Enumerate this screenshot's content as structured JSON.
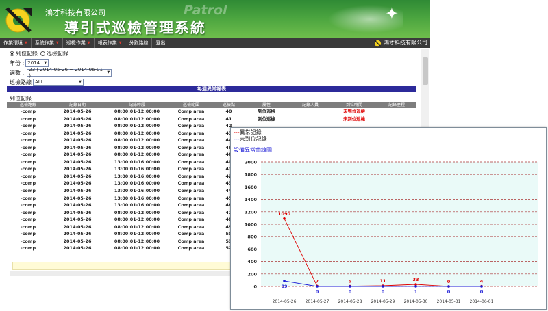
{
  "header": {
    "company": "鴻才科技有限公司",
    "system_title": "導引式巡檢管理系統",
    "watermark": "Patrol"
  },
  "menu": [
    {
      "label": "作業環境",
      "has_dropdown": true
    },
    {
      "label": "系統作業",
      "has_dropdown": true
    },
    {
      "label": "巡檢作業",
      "has_dropdown": true
    },
    {
      "label": "報表作業",
      "has_dropdown": true
    },
    {
      "label": "分割路線",
      "has_dropdown": false
    },
    {
      "label": "登出",
      "has_dropdown": false
    }
  ],
  "menu_brand": "鴻才科技有限公司",
  "filters": {
    "radio_arrived": "到位記錄",
    "radio_inspect": "巡檢記錄",
    "year_label": "年份 :",
    "year_value": "2014",
    "week_label": "週數 :",
    "week_value": "23 ( 2014-05-26 ~ 2014-06-01 )",
    "route_label": "巡檢路線",
    "route_value": "ALL"
  },
  "report": {
    "title": "每週異常報表",
    "section": "到位記錄",
    "columns": [
      "巡檢路線",
      "記錄日期",
      "記錄時段",
      "巡檢範圍",
      "巡檢點",
      "屬性",
      "記錄人員",
      "到位時間",
      "記錄歷程"
    ],
    "rows": [
      [
        "-comp",
        "2014-05-26",
        "08:00:01-12:00:00",
        "Comp area",
        "40",
        "到位巡檢",
        "",
        "未到位巡檢",
        ""
      ],
      [
        "-comp",
        "2014-05-26",
        "08:00:01-12:00:00",
        "Comp area",
        "41",
        "到位巡檢",
        "",
        "未到位巡檢",
        ""
      ],
      [
        "-comp",
        "2014-05-26",
        "08:00:01-12:00:00",
        "Comp area",
        "42",
        "",
        "",
        "",
        ""
      ],
      [
        "-comp",
        "2014-05-26",
        "08:00:01-12:00:00",
        "Comp area",
        "43",
        "",
        "",
        "",
        ""
      ],
      [
        "-comp",
        "2014-05-26",
        "08:00:01-12:00:00",
        "Comp area",
        "44",
        "",
        "",
        "",
        ""
      ],
      [
        "-comp",
        "2014-05-26",
        "08:00:01-12:00:00",
        "Comp area",
        "45",
        "",
        "",
        "",
        ""
      ],
      [
        "-comp",
        "2014-05-26",
        "08:00:01-12:00:00",
        "Comp area",
        "46",
        "",
        "",
        "",
        ""
      ],
      [
        "-comp",
        "2014-05-26",
        "13:00:01-16:00:00",
        "Comp area",
        "40",
        "",
        "",
        "",
        ""
      ],
      [
        "-comp",
        "2014-05-26",
        "13:00:01-16:00:00",
        "Comp area",
        "41",
        "",
        "",
        "",
        ""
      ],
      [
        "-comp",
        "2014-05-26",
        "13:00:01-16:00:00",
        "Comp area",
        "42",
        "",
        "",
        "",
        ""
      ],
      [
        "-comp",
        "2014-05-26",
        "13:00:01-16:00:00",
        "Comp area",
        "43",
        "",
        "",
        "",
        ""
      ],
      [
        "-comp",
        "2014-05-26",
        "13:00:01-16:00:00",
        "Comp area",
        "44",
        "",
        "",
        "",
        ""
      ],
      [
        "-comp",
        "2014-05-26",
        "13:00:01-16:00:00",
        "Comp area",
        "45",
        "",
        "",
        "",
        ""
      ],
      [
        "-comp",
        "2014-05-26",
        "13:00:01-16:00:00",
        "Comp area",
        "46",
        "",
        "",
        "",
        ""
      ],
      [
        "-comp",
        "2014-05-26",
        "08:00:01-12:00:00",
        "Comp area",
        "47",
        "",
        "",
        "",
        ""
      ],
      [
        "-comp",
        "2014-05-26",
        "08:00:01-12:00:00",
        "Comp area",
        "48",
        "",
        "",
        "",
        ""
      ],
      [
        "-comp",
        "2014-05-26",
        "08:00:01-12:00:00",
        "Comp area",
        "49",
        "",
        "",
        "",
        ""
      ],
      [
        "-comp",
        "2014-05-26",
        "08:00:01-12:00:00",
        "Comp area",
        "50",
        "",
        "",
        "",
        ""
      ],
      [
        "-comp",
        "2014-05-26",
        "08:00:01-12:00:00",
        "Comp area",
        "51",
        "",
        "",
        "",
        ""
      ],
      [
        "-comp",
        "2014-05-26",
        "08:00:01-12:00:00",
        "Comp area",
        "52",
        "",
        "",
        "",
        ""
      ]
    ]
  },
  "chart_data": {
    "type": "line",
    "title": "設備異常曲線圖",
    "x": [
      "2014-05-26",
      "2014-05-27",
      "2014-05-28",
      "2014-05-29",
      "2014-05-30",
      "2014-05-31",
      "2014-06-01"
    ],
    "series": [
      {
        "name": "異常記錄",
        "color": "#e00000",
        "values": [
          1090,
          7,
          5,
          11,
          33,
          0,
          4
        ]
      },
      {
        "name": "未到位記錄",
        "color": "#1a1ad6",
        "values": [
          89,
          0,
          0,
          0,
          1,
          0,
          0
        ]
      }
    ],
    "yticks": [
      0,
      200,
      400,
      600,
      800,
      1000,
      1200,
      1400,
      1600,
      1800,
      2000
    ],
    "ylim": [
      0,
      2000
    ],
    "grid": true,
    "legend_position": "top-left"
  },
  "colors": {
    "header_green": "#4aa43f",
    "menu_dark": "#3a3a3a",
    "report_bar": "#2c2a9a",
    "alert_red": "#e00000"
  }
}
